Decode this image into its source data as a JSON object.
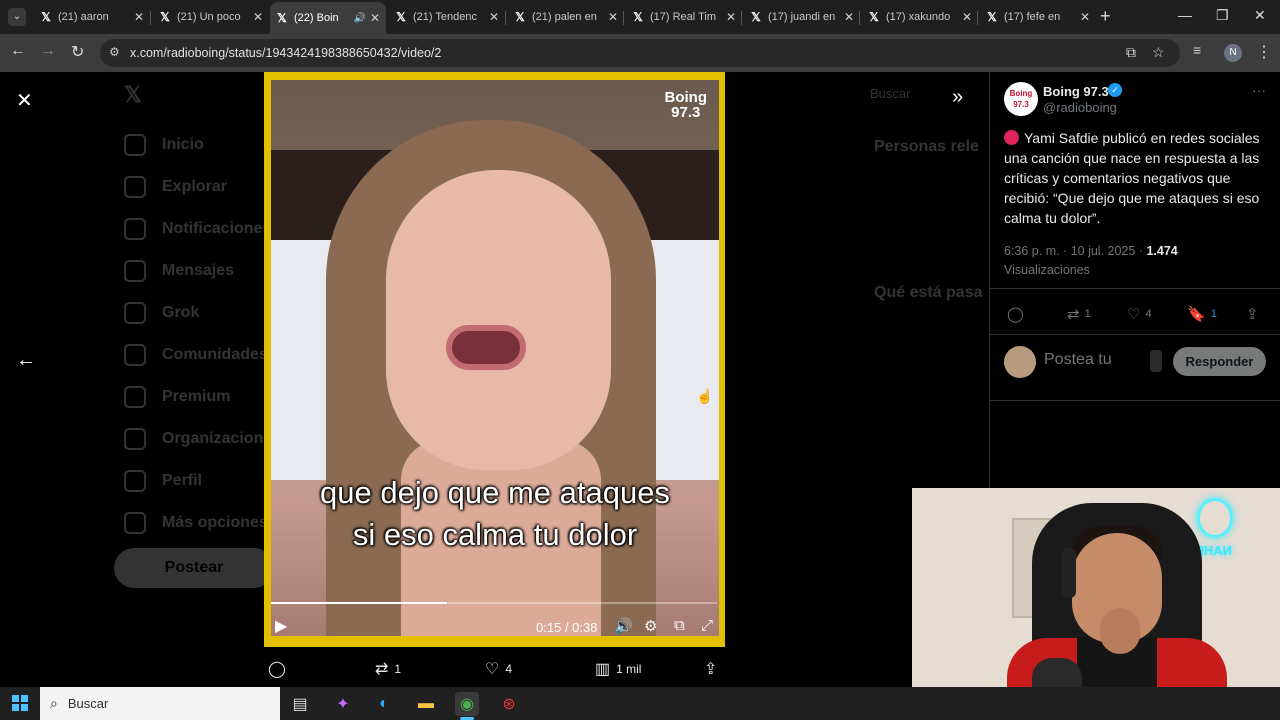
{
  "browser": {
    "tabs": [
      {
        "title": "(21) aaron",
        "active": false,
        "audio": false
      },
      {
        "title": "(21) Un poco",
        "active": false,
        "audio": false
      },
      {
        "title": "(22) Boin",
        "active": true,
        "audio": true
      },
      {
        "title": "(21) Tendenc",
        "active": false,
        "audio": false
      },
      {
        "title": "(21) palen en",
        "active": false,
        "audio": false
      },
      {
        "title": "(17) Real Tim",
        "active": false,
        "audio": false
      },
      {
        "title": "(17) juandi en",
        "active": false,
        "audio": false
      },
      {
        "title": "(17) xakundo",
        "active": false,
        "audio": false
      },
      {
        "title": "(17) fefe en",
        "active": false,
        "audio": false
      }
    ],
    "url": "x.com/radioboing/status/1943424198388650432/video/2",
    "profile_initial": "N"
  },
  "background_page": {
    "nav": [
      "Inicio",
      "Explorar",
      "Notificaciones",
      "Mensajes",
      "Grok",
      "Comunidades",
      "Premium",
      "Organizaciones",
      "Perfil",
      "Más opciones"
    ],
    "post_button": "Postear",
    "search_placeholder": "Buscar",
    "right_headings": [
      "Personas rele",
      "Qué está pasa"
    ]
  },
  "video": {
    "brand_line1": "Boing",
    "brand_line2": "97.3",
    "caption_line1": "que dejo que me ataques",
    "caption_line2": "si eso calma tu dolor",
    "time": "0:15 / 0:38",
    "progress_fraction": 0.3947,
    "border_color": "#e2c000"
  },
  "video_actions": {
    "retweets": "1",
    "likes": "4",
    "views": "1 mil"
  },
  "tweet": {
    "display_name": "Boing 97.3",
    "handle": "@radioboing",
    "avatar_line1": "Boing",
    "avatar_line2": "97.3",
    "text": "Yami Safdie publicó en redes sociales una canción que nace en respuesta a las críticas y comentarios negativos que recibió: “Que dejo que me ataques si eso calma tu dolor”.",
    "timestamp": "6:36 p. m. · 10 jul. 2025 · ",
    "views_count": "1.474",
    "views_label": "Visualizaciones",
    "retweets": "1",
    "likes": "4",
    "bookmarks": "1",
    "reply_placeholder": "Postea tu",
    "reply_button": "Responder",
    "accent_color": "#1d9bf0"
  },
  "webcam": {
    "neon_text": "NAHDIOS"
  },
  "taskbar": {
    "search_label": "Buscar"
  }
}
